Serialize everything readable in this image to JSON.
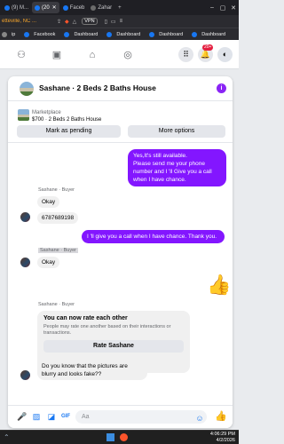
{
  "browser": {
    "tabs": [
      {
        "label": "(9) M...",
        "color": "#1877f2",
        "active": false
      },
      {
        "label": "(20",
        "color": "#1877f2",
        "active": true
      },
      {
        "label": "Faceb",
        "color": "#1877f2",
        "active": false
      },
      {
        "label": "Zahar",
        "color": "#6b6b6b",
        "active": false
      },
      {
        "label": "+",
        "color": "",
        "active": false
      }
    ],
    "address_partial": "etteville, NC ...",
    "vpn_label": "VPN",
    "bookmarks": [
      "ip",
      "Facebook",
      "Dashboard",
      "Dashboard",
      "Dashboard",
      "Dashboard"
    ]
  },
  "fb_nav": {
    "notification_badge": "20+"
  },
  "conversation": {
    "title": "Sashane · 2 Beds 2 Baths House",
    "listing_label": "Marketplace",
    "listing_desc": "$700 · 2 Beds 2 Baths House",
    "mark_pending": "Mark as pending",
    "more_options": "More options",
    "messages": {
      "sent1": "Yes,It's still available.\nPlease send me your phone number and I 'll Give you a call when I have chance.",
      "buyer_label1": "Sashane · Buyer",
      "okay1": "Okay",
      "phone": "6787689198",
      "sent2": "I 'll give you a call when I have chance. Thank you.",
      "buyer_label2": "Sashane · Buyer",
      "okay2": "Okay",
      "buyer_label3": "Sashane · Buyer",
      "last": "Do you know that the pictures are blurry and looks fake??"
    },
    "rate_card": {
      "title": "You can now rate each other",
      "desc": "People may rate one another based on their interactions or transactions.",
      "button": "Rate Sashane"
    },
    "composer_placeholder": "Aa"
  },
  "taskbar": {
    "time": "4:06:29 PM",
    "date": "4/2/2026"
  },
  "colors": {
    "accent": "#8316ff",
    "fb_blue": "#1877f2"
  }
}
